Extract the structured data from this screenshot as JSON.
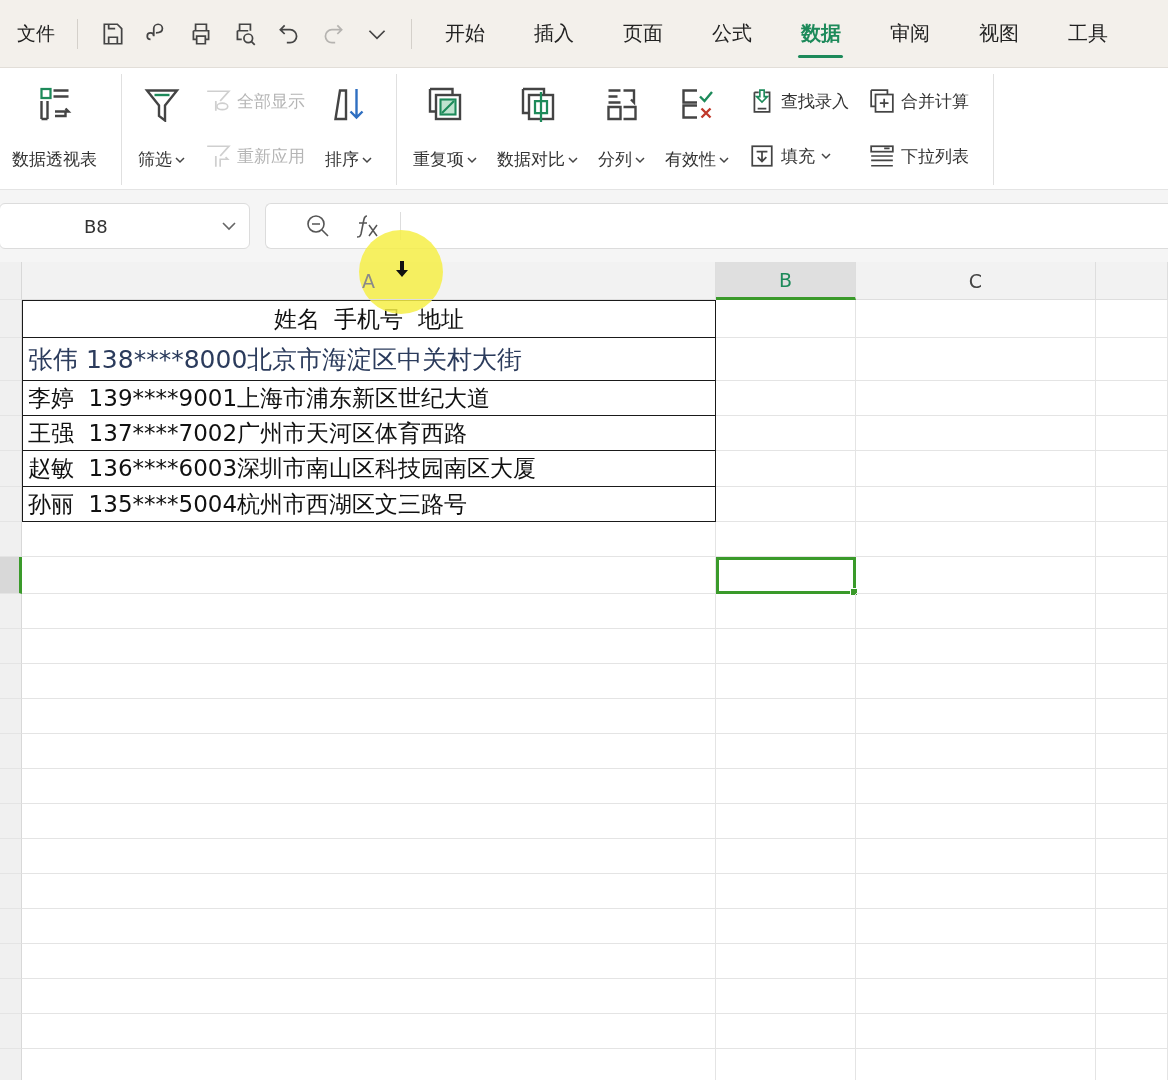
{
  "menu_bar": {
    "file_label": "文件",
    "quick_access": [
      {
        "disabled": false
      },
      {
        "disabled": false
      },
      {
        "disabled": false
      },
      {
        "disabled": false
      },
      {
        "disabled": false
      },
      {
        "disabled": true
      },
      {
        "disabled": false
      }
    ],
    "tabs": [
      {
        "label": "开始",
        "selected": false
      },
      {
        "label": "插入",
        "selected": false
      },
      {
        "label": "页面",
        "selected": false
      },
      {
        "label": "公式",
        "selected": false
      },
      {
        "label": "数据",
        "selected": true
      },
      {
        "label": "审阅",
        "selected": false
      },
      {
        "label": "视图",
        "selected": false
      },
      {
        "label": "工具",
        "selected": false
      }
    ]
  },
  "ribbon": {
    "groups": [
      {
        "items": [
          {
            "kind": "large",
            "label": "数据透视表",
            "dropdown": false,
            "disabled": false
          }
        ]
      },
      {
        "items": [
          {
            "kind": "large",
            "label": "筛选",
            "dropdown": true,
            "disabled": false
          },
          {
            "kind": "stack",
            "items": [
              {
                "label": "全部显示",
                "dropdown": false,
                "disabled": true
              },
              {
                "label": "重新应用",
                "dropdown": false,
                "disabled": true
              }
            ]
          },
          {
            "kind": "large",
            "label": "排序",
            "dropdown": true,
            "disabled": false
          }
        ]
      },
      {
        "items": [
          {
            "kind": "large",
            "label": "重复项",
            "dropdown": true,
            "disabled": false
          },
          {
            "kind": "large",
            "label": "数据对比",
            "dropdown": true,
            "disabled": false
          },
          {
            "kind": "large",
            "label": "分列",
            "dropdown": true,
            "disabled": false
          },
          {
            "kind": "large",
            "label": "有效性",
            "dropdown": true,
            "disabled": false
          },
          {
            "kind": "stack",
            "items": [
              {
                "label": "查找录入",
                "dropdown": false,
                "disabled": false
              },
              {
                "label": "填充",
                "dropdown": true,
                "disabled": false
              }
            ]
          },
          {
            "kind": "stack",
            "items": [
              {
                "label": "合并计算",
                "dropdown": false,
                "disabled": false
              },
              {
                "label": "下拉列表",
                "dropdown": false,
                "disabled": false
              }
            ]
          }
        ]
      }
    ]
  },
  "name_box": {
    "value": "B8"
  },
  "sheet": {
    "columns": [
      {
        "label": "A",
        "selected": false
      },
      {
        "label": "B",
        "selected": true
      },
      {
        "label": "C",
        "selected": false
      }
    ],
    "rows": [
      {
        "kind": "heading",
        "a": "姓名  手机号  地址",
        "bordered": true,
        "emphasis": false,
        "selected": false
      },
      {
        "kind": "data",
        "a": "张伟 138****8000北京市海淀区中关村大街",
        "bordered": true,
        "emphasis": true,
        "selected": false
      },
      {
        "kind": "data",
        "a": "李婷  139****9001上海市浦东新区世纪大道",
        "bordered": true,
        "emphasis": false,
        "selected": false
      },
      {
        "kind": "data",
        "a": "王强  137****7002广州市天河区体育西路",
        "bordered": true,
        "emphasis": false,
        "selected": false
      },
      {
        "kind": "data",
        "a": "赵敏  136****6003深圳市南山区科技园南区大厦",
        "bordered": true,
        "emphasis": false,
        "selected": false
      },
      {
        "kind": "data",
        "a": "孙丽  135****5004杭州市西湖区文三路号",
        "bordered": true,
        "emphasis": false,
        "selected": false
      },
      {
        "kind": "data",
        "bordered": false,
        "selected": false
      },
      {
        "kind": "data",
        "bordered": false,
        "selected": true
      }
    ]
  }
}
